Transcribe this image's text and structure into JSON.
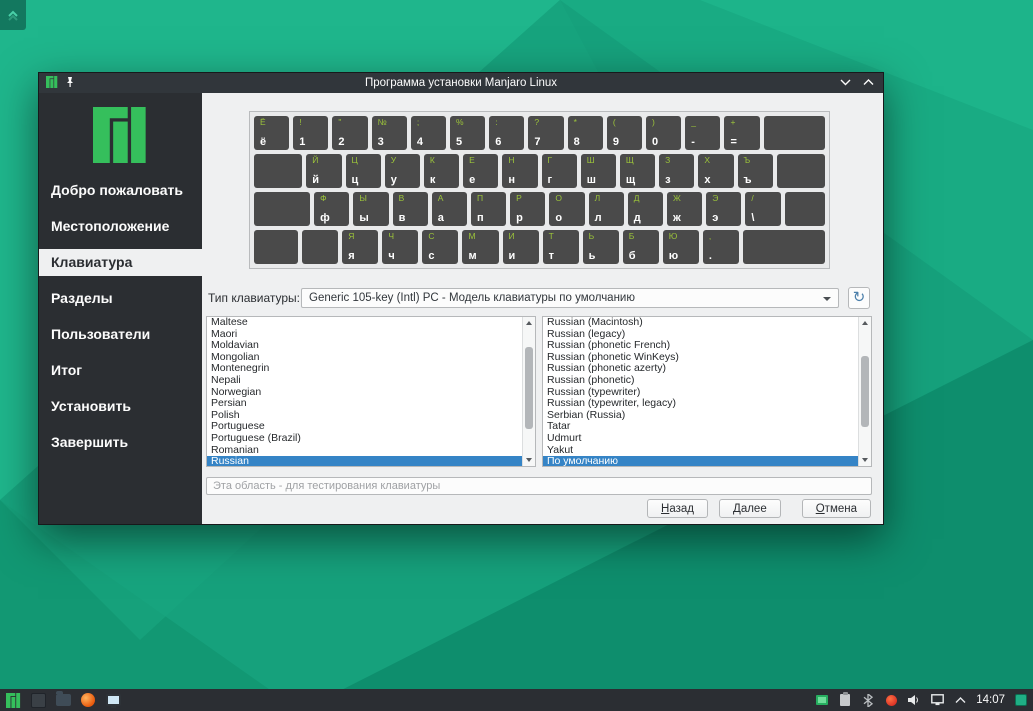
{
  "titlebar": {
    "title": "Программа установки Manjaro Linux"
  },
  "sidebar": {
    "items": [
      {
        "label": "Добро пожаловать",
        "active": false
      },
      {
        "label": "Местоположение",
        "active": false
      },
      {
        "label": "Клавиатура",
        "active": true
      },
      {
        "label": "Разделы",
        "active": false
      },
      {
        "label": "Пользователи",
        "active": false
      },
      {
        "label": "Итог",
        "active": false
      },
      {
        "label": "Установить",
        "active": false
      },
      {
        "label": "Завершить",
        "active": false
      }
    ]
  },
  "keyboard_page": {
    "model_label": "Тип клавиатуры:",
    "model_value": "Generic 105-key (Intl) PC  -  Модель клавиатуры по умолчанию",
    "layouts": [
      "Maltese",
      "Maori",
      "Moldavian",
      "Mongolian",
      "Montenegrin",
      "Nepali",
      "Norwegian",
      "Persian",
      "Polish",
      "Portuguese",
      "Portuguese (Brazil)",
      "Romanian",
      "Russian"
    ],
    "selected_layout": "Russian",
    "variants": [
      "Russian (Macintosh)",
      "Russian (legacy)",
      "Russian (phonetic French)",
      "Russian (phonetic WinKeys)",
      "Russian (phonetic azerty)",
      "Russian (phonetic)",
      "Russian (typewriter)",
      "Russian (typewriter, legacy)",
      "Serbian (Russia)",
      "Tatar",
      "Udmurt",
      "Yakut",
      "По умолчанию"
    ],
    "selected_variant": "По умолчанию",
    "test_placeholder": "Эта область - для тестирования клавиатуры",
    "buttons": [
      {
        "name": "back",
        "label": "Назад",
        "mnemonic": 0
      },
      {
        "name": "next",
        "label": "Далее",
        "mnemonic": 0
      },
      {
        "name": "cancel",
        "label": "Отмена",
        "mnemonic": 0
      }
    ],
    "keyboard_rows": [
      [
        {
          "t": "Ё",
          "b": "ё"
        },
        {
          "t": "!",
          "b": "1"
        },
        {
          "t": "\"",
          "b": "2"
        },
        {
          "t": "№",
          "b": "3"
        },
        {
          "t": ";",
          "b": "4"
        },
        {
          "t": "%",
          "b": "5"
        },
        {
          "t": ":",
          "b": "6"
        },
        {
          "t": "?",
          "b": "7"
        },
        {
          "t": "*",
          "b": "8"
        },
        {
          "t": "(",
          "b": "9"
        },
        {
          "t": ")",
          "b": "0"
        },
        {
          "t": "_",
          "b": "-"
        },
        {
          "t": "+",
          "b": "="
        },
        {
          "w": 2.0
        }
      ],
      [
        {
          "w": 1.5
        },
        {
          "t": "Й",
          "b": "й"
        },
        {
          "t": "Ц",
          "b": "ц"
        },
        {
          "t": "У",
          "b": "у"
        },
        {
          "t": "К",
          "b": "к"
        },
        {
          "t": "Е",
          "b": "е"
        },
        {
          "t": "Н",
          "b": "н"
        },
        {
          "t": "Г",
          "b": "г"
        },
        {
          "t": "Ш",
          "b": "ш"
        },
        {
          "t": "Щ",
          "b": "щ"
        },
        {
          "t": "З",
          "b": "з"
        },
        {
          "t": "Х",
          "b": "х"
        },
        {
          "t": "Ъ",
          "b": "ъ"
        },
        {
          "w": 1.5
        }
      ],
      [
        {
          "w": 1.8
        },
        {
          "t": "Ф",
          "b": "ф"
        },
        {
          "t": "Ы",
          "b": "ы"
        },
        {
          "t": "В",
          "b": "в"
        },
        {
          "t": "А",
          "b": "а"
        },
        {
          "t": "П",
          "b": "п"
        },
        {
          "t": "Р",
          "b": "р"
        },
        {
          "t": "О",
          "b": "о"
        },
        {
          "t": "Л",
          "b": "л"
        },
        {
          "t": "Д",
          "b": "д"
        },
        {
          "t": "Ж",
          "b": "ж"
        },
        {
          "t": "Э",
          "b": "э"
        },
        {
          "t": "/",
          "b": "\\"
        },
        {
          "w": 1.2
        }
      ],
      [
        {
          "w": 1.3
        },
        {
          "w": 1.0
        },
        {
          "t": "Я",
          "b": "я"
        },
        {
          "t": "Ч",
          "b": "ч"
        },
        {
          "t": "С",
          "b": "с"
        },
        {
          "t": "М",
          "b": "м"
        },
        {
          "t": "И",
          "b": "и"
        },
        {
          "t": "Т",
          "b": "т"
        },
        {
          "t": "Ь",
          "b": "ь"
        },
        {
          "t": "Б",
          "b": "б"
        },
        {
          "t": "Ю",
          "b": "ю"
        },
        {
          "t": ",",
          "b": "."
        },
        {
          "w": 2.7
        }
      ]
    ]
  },
  "taskbar": {
    "clock": "14:07"
  },
  "colors": {
    "manjaro_green": "#35bf5c",
    "highlight": "#3584c6",
    "key_shift_label": "#9cc43a"
  }
}
